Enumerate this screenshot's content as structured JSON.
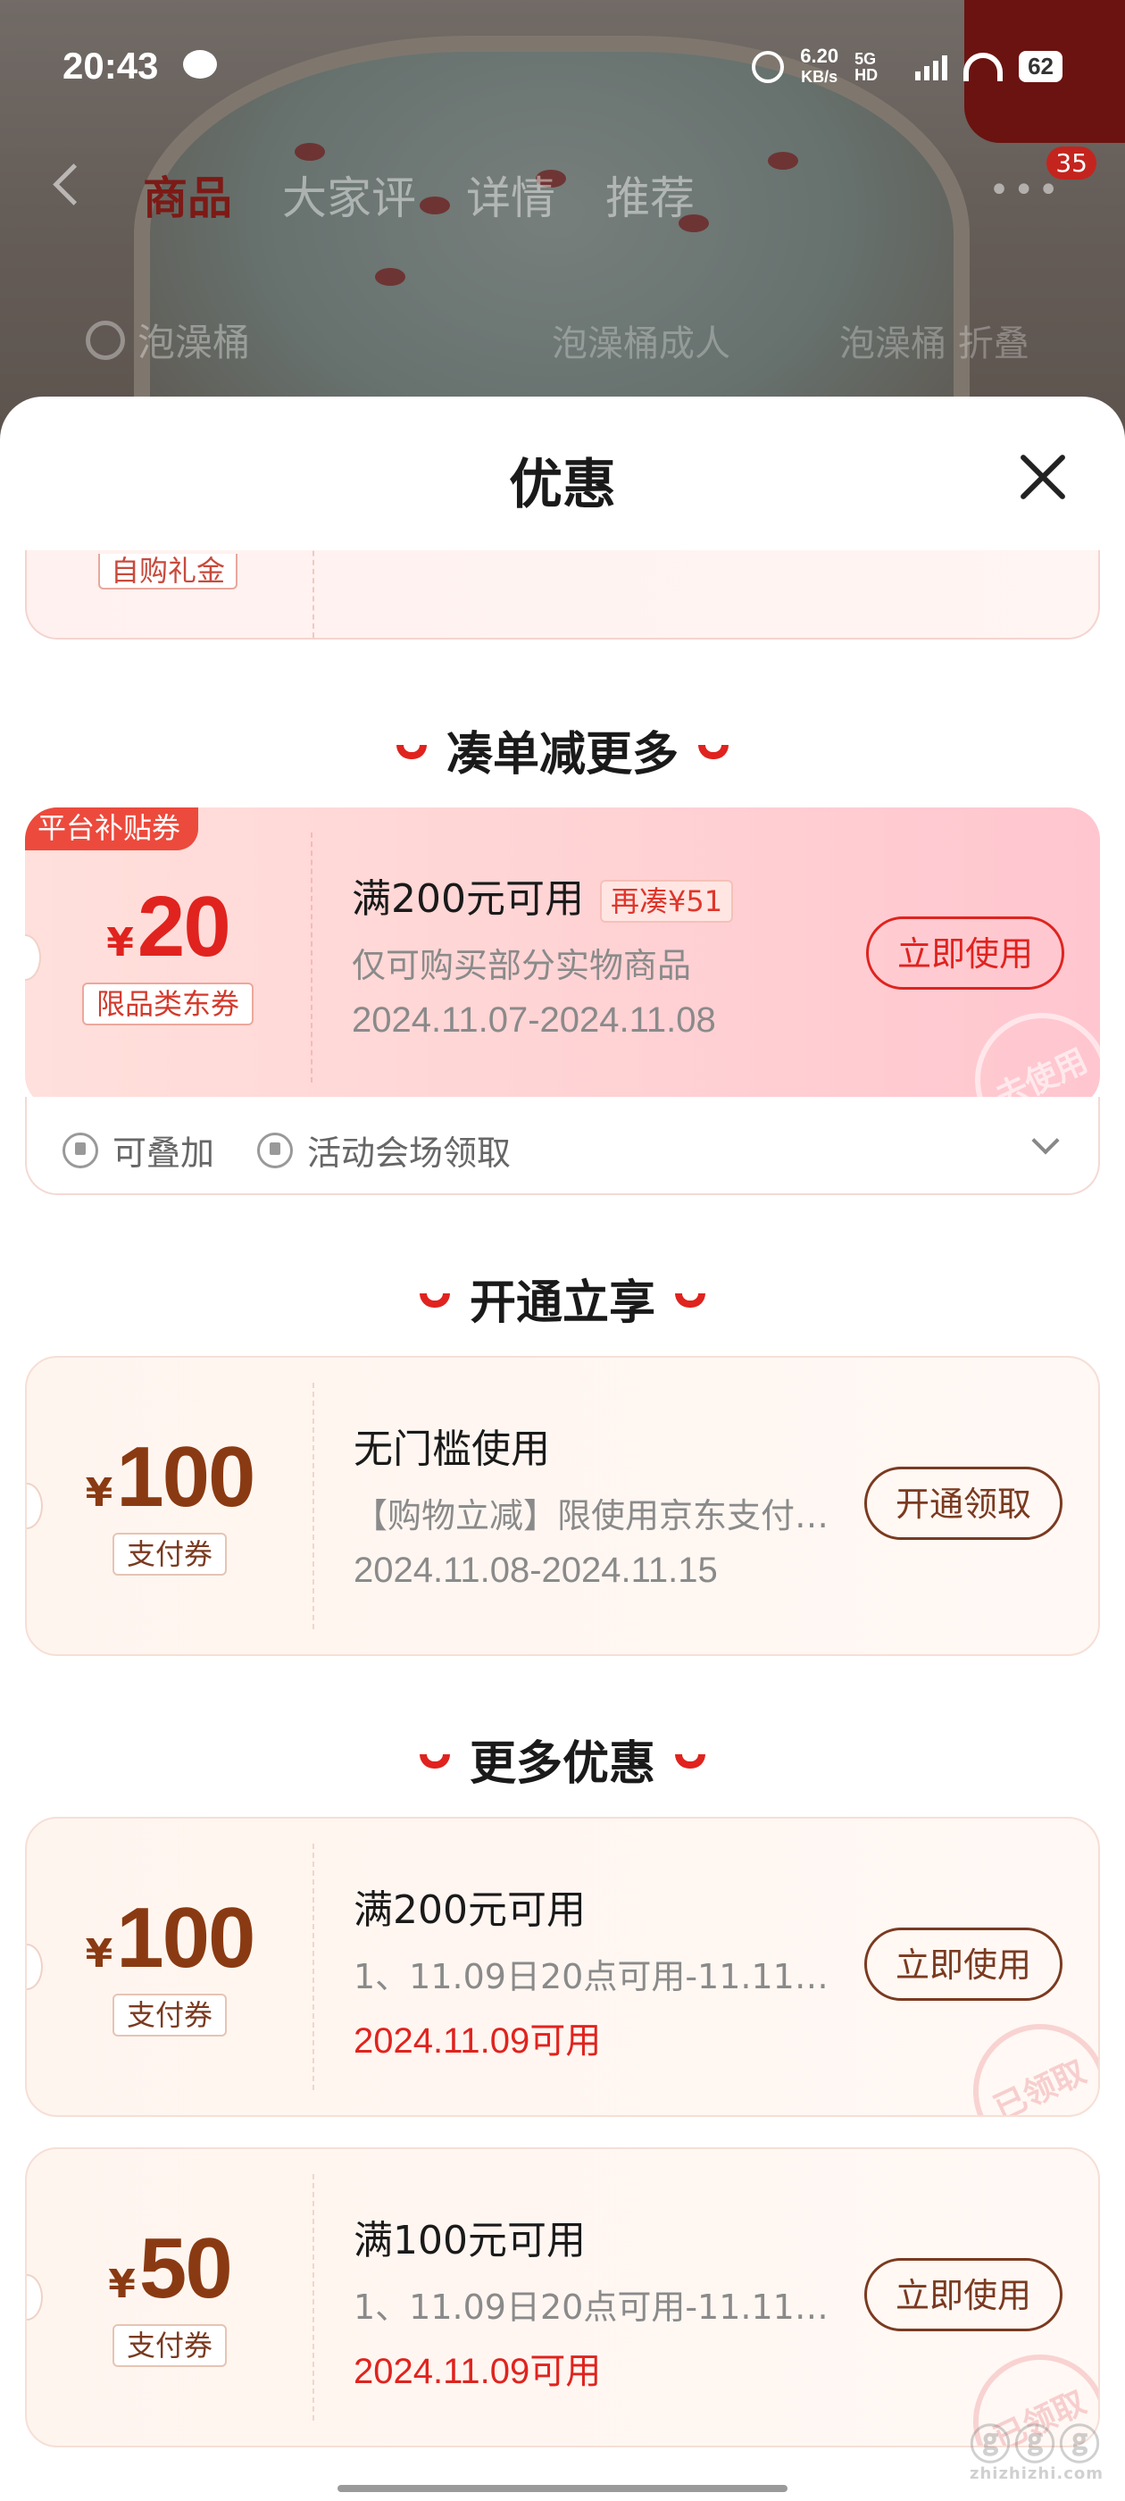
{
  "status_bar": {
    "time": "20:43",
    "speed_value": "6.20",
    "speed_unit": "KB/s",
    "network": "5G HD",
    "battery": "62"
  },
  "background_page": {
    "tabs": [
      "商品",
      "大家评",
      "详情",
      "推荐"
    ],
    "active_tab": "商品",
    "badge": "35",
    "search_text": "泡澡桶",
    "chips": [
      "泡澡桶成人",
      "泡澡桶 折叠"
    ]
  },
  "sheet": {
    "title": "优惠",
    "partial_card_tag": "自购礼金"
  },
  "sections": [
    {
      "title": "凑单减更多"
    },
    {
      "title": "开通立享"
    },
    {
      "title": "更多优惠"
    }
  ],
  "coupons": {
    "platform": {
      "corner_tag": "平台补贴券",
      "currency": "¥",
      "amount": "20",
      "type_tag": "限品类东券",
      "condition": "满200元可用",
      "extra_tag": "再凑¥51",
      "desc": "仅可购买部分实物商品",
      "validity": "2024.11.07-2024.11.08",
      "button": "立即使用",
      "stamp": "去使用",
      "footer": [
        "可叠加",
        "活动会场领取"
      ]
    },
    "open": {
      "currency": "¥",
      "amount": "100",
      "type_tag": "支付券",
      "condition": "无门槛使用",
      "desc": "【购物立减】限使用京东支付…",
      "validity": "2024.11.08-2024.11.15",
      "button": "开通领取"
    },
    "more": [
      {
        "currency": "¥",
        "amount": "100",
        "type_tag": "支付券",
        "condition": "满200元可用",
        "desc": "1、11.09日20点可用-11.11…",
        "validity": "2024.11.09可用",
        "button": "立即使用",
        "stamp": "已领取"
      },
      {
        "currency": "¥",
        "amount": "50",
        "type_tag": "支付券",
        "condition": "满100元可用",
        "desc": "1、11.09日20点可用-11.11…",
        "validity": "2024.11.09可用",
        "button": "立即使用",
        "stamp": "已领取"
      }
    ]
  },
  "watermark": {
    "main": "ⓖⓖⓖ",
    "sub": "zhizhizhi.com"
  },
  "colors": {
    "accent": "#e0231e",
    "brown": "#8a3a12",
    "button_border_brown": "#7a3a20"
  }
}
